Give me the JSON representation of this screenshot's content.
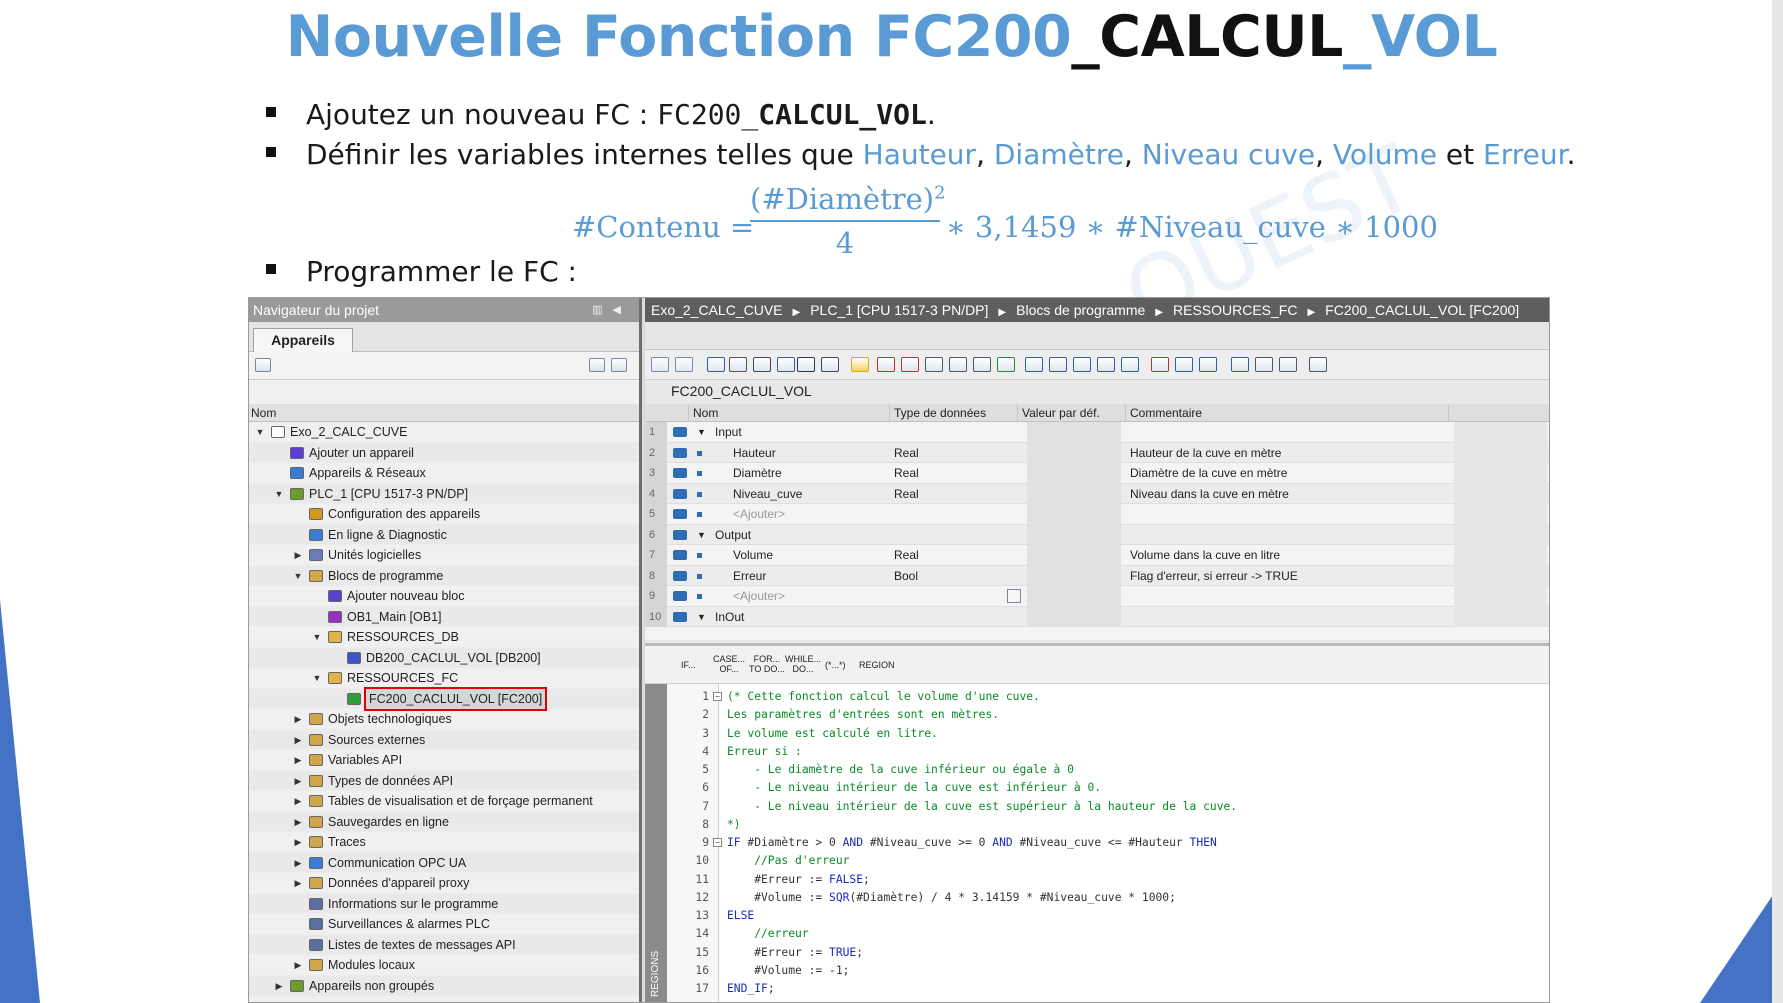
{
  "slide": {
    "title_prefix": "Nouvelle Fonction FC200",
    "title_mid": "_CALCUL",
    "title_suffix": "_VOL",
    "bullet1_text": "Ajoutez un nouveau FC : ",
    "bullet1_code_a": "FC200_",
    "bullet1_code_b": "CALCUL_VOL",
    "bullet1_end": ".",
    "bullet2_text": "Définir les variables internes telles que ",
    "bullet2_vars": [
      "Hauteur",
      "Diamètre",
      "Niveau cuve",
      "Volume",
      "Erreur"
    ],
    "bullet2_sep1": ", ",
    "bullet2_and": " et ",
    "bullet2_end": ".",
    "bullet3_text": "Programmer le FC :",
    "formula": {
      "lhs": "#Contenu =",
      "numerator": "(#Diamètre)",
      "exponent": "2",
      "denominator": "4",
      "rhs": "∗ 3,1459 ∗ #Niveau_cuve  ∗ 1000"
    }
  },
  "navigator": {
    "title": "Navigateur du projet",
    "tab": "Appareils",
    "column": "Nom",
    "tree": [
      {
        "label": "Exo_2_CALC_CUVE",
        "level": 0,
        "exp": "▼",
        "icon": "project-icon",
        "color": "#ffffff"
      },
      {
        "label": "Ajouter un appareil",
        "level": 1,
        "exp": "",
        "icon": "add-device-icon",
        "color": "#5a3fd0"
      },
      {
        "label": "Appareils & Réseaux",
        "level": 1,
        "exp": "",
        "icon": "network-icon",
        "color": "#3a7bd5"
      },
      {
        "label": "PLC_1 [CPU 1517-3 PN/DP]",
        "level": 1,
        "exp": "▼",
        "icon": "plc-icon",
        "color": "#6c9c2d"
      },
      {
        "label": "Configuration des appareils",
        "level": 2,
        "exp": "",
        "icon": "config-icon",
        "color": "#d09a1f"
      },
      {
        "label": "En ligne & Diagnostic",
        "level": 2,
        "exp": "",
        "icon": "diagnostic-icon",
        "color": "#3a7bd5"
      },
      {
        "label": "Unités logicielles",
        "level": 2,
        "exp": "▶",
        "icon": "software-units-icon",
        "color": "#6b7bb5"
      },
      {
        "label": "Blocs de programme",
        "level": 2,
        "exp": "▼",
        "icon": "program-blocks-icon",
        "color": "#d0a64a"
      },
      {
        "label": "Ajouter nouveau bloc",
        "level": 3,
        "exp": "",
        "icon": "add-block-icon",
        "color": "#5a3fd0"
      },
      {
        "label": "OB1_Main [OB1]",
        "level": 3,
        "exp": "",
        "icon": "ob-icon",
        "color": "#9a2fc6"
      },
      {
        "label": "RESSOURCES_DB",
        "level": 3,
        "exp": "▼",
        "icon": "folder-icon",
        "color": "#e0b44a"
      },
      {
        "label": "DB200_CACLUL_VOL [DB200]",
        "level": 4,
        "exp": "",
        "icon": "db-icon",
        "color": "#3a56c8"
      },
      {
        "label": "RESSOURCES_FC",
        "level": 3,
        "exp": "▼",
        "icon": "folder-icon",
        "color": "#e0b44a"
      },
      {
        "label": "FC200_CACLUL_VOL [FC200]",
        "level": 4,
        "exp": "",
        "icon": "fc-icon",
        "color": "#2e9e3a",
        "highlight": true
      },
      {
        "label": "Objets technologiques",
        "level": 2,
        "exp": "▶",
        "icon": "tech-objects-icon",
        "color": "#d0a64a"
      },
      {
        "label": "Sources externes",
        "level": 2,
        "exp": "▶",
        "icon": "external-sources-icon",
        "color": "#d0a64a"
      },
      {
        "label": "Variables API",
        "level": 2,
        "exp": "▶",
        "icon": "plc-tags-icon",
        "color": "#d0a64a"
      },
      {
        "label": "Types de données API",
        "level": 2,
        "exp": "▶",
        "icon": "data-types-icon",
        "color": "#d0a64a"
      },
      {
        "label": "Tables de visualisation et de forçage permanent",
        "level": 2,
        "exp": "▶",
        "icon": "watch-tables-icon",
        "color": "#d0a64a"
      },
      {
        "label": "Sauvegardes en ligne",
        "level": 2,
        "exp": "▶",
        "icon": "online-backup-icon",
        "color": "#d0a64a"
      },
      {
        "label": "Traces",
        "level": 2,
        "exp": "▶",
        "icon": "traces-icon",
        "color": "#d0a64a"
      },
      {
        "label": "Communication OPC UA",
        "level": 2,
        "exp": "▶",
        "icon": "opcua-icon",
        "color": "#3a7bd5"
      },
      {
        "label": "Données d'appareil proxy",
        "level": 2,
        "exp": "▶",
        "icon": "proxy-data-icon",
        "color": "#d0a64a"
      },
      {
        "label": "Informations sur le programme",
        "level": 2,
        "exp": "",
        "icon": "program-info-icon",
        "color": "#5a6fa0"
      },
      {
        "label": "Surveillances & alarmes PLC",
        "level": 2,
        "exp": "",
        "icon": "alarms-icon",
        "color": "#5a6fa0"
      },
      {
        "label": "Listes de textes de messages API",
        "level": 2,
        "exp": "",
        "icon": "text-lists-icon",
        "color": "#5a6fa0"
      },
      {
        "label": "Modules locaux",
        "level": 2,
        "exp": "▶",
        "icon": "local-modules-icon",
        "color": "#d0a64a"
      },
      {
        "label": "Appareils non groupés",
        "level": 1,
        "exp": "▶",
        "icon": "ungrouped-devices-icon",
        "color": "#6c9c2d"
      }
    ]
  },
  "editor": {
    "breadcrumb": [
      "Exo_2_CALC_CUVE",
      "PLC_1 [CPU 1517-3 PN/DP]",
      "Blocs de programme",
      "RESSOURCES_FC",
      "FC200_CACLUL_VOL [FC200]"
    ],
    "block_name": "FC200_CACLUL_VOL",
    "columns": {
      "name": "Nom",
      "type": "Type de données",
      "default": "Valeur par déf.",
      "comment": "Commentaire"
    },
    "interface": [
      {
        "n": "1",
        "name": "Input",
        "type": "",
        "comment": "",
        "section": true
      },
      {
        "n": "2",
        "name": "Hauteur",
        "type": "Real",
        "comment": "Hauteur de la cuve en mètre"
      },
      {
        "n": "3",
        "name": "Diamètre",
        "type": "Real",
        "comment": "Diamètre de la cuve en mètre"
      },
      {
        "n": "4",
        "name": "Niveau_cuve",
        "type": "Real",
        "comment": "Niveau dans la cuve en mètre"
      },
      {
        "n": "5",
        "name": "<Ajouter>",
        "type": "",
        "comment": "",
        "placeholder": true
      },
      {
        "n": "6",
        "name": "Output",
        "type": "",
        "comment": "",
        "section": true
      },
      {
        "n": "7",
        "name": "Volume",
        "type": "Real",
        "comment": "Volume dans la cuve en litre"
      },
      {
        "n": "8",
        "name": "Erreur",
        "type": "Bool",
        "comment": "Flag d'erreur, si erreur -> TRUE"
      },
      {
        "n": "9",
        "name": "<Ajouter>",
        "type": "",
        "comment": "",
        "placeholder": true
      },
      {
        "n": "10",
        "name": "InOut",
        "type": "",
        "comment": "",
        "section": true
      }
    ],
    "code_tools": [
      {
        "l1": "IF...",
        "l2": ""
      },
      {
        "l1": "CASE...",
        "l2": "OF..."
      },
      {
        "l1": "FOR...",
        "l2": "TO DO..."
      },
      {
        "l1": "WHILE...",
        "l2": "DO..."
      },
      {
        "l1": "(*...*)",
        "l2": ""
      },
      {
        "l1": "REGION",
        "l2": ""
      }
    ],
    "regions_label": "REGIONS",
    "code": [
      {
        "n": "1",
        "fold": "−",
        "segs": [
          [
            "cmt",
            "(* Cette fonction calcul le volume d'une cuve."
          ]
        ]
      },
      {
        "n": "2",
        "segs": [
          [
            "cmt",
            "Les paramètres d'entrées sont en mètres."
          ]
        ]
      },
      {
        "n": "3",
        "segs": [
          [
            "cmt",
            "Le volume est calculé en litre."
          ]
        ]
      },
      {
        "n": "4",
        "segs": [
          [
            "cmt",
            "Erreur si :"
          ]
        ]
      },
      {
        "n": "5",
        "segs": [
          [
            "cmt",
            "    - Le diamètre de la cuve inférieur ou égale à 0"
          ]
        ]
      },
      {
        "n": "6",
        "segs": [
          [
            "cmt",
            "    - Le niveau intérieur de la cuve est inférieur à 0."
          ]
        ]
      },
      {
        "n": "7",
        "segs": [
          [
            "cmt",
            "    - Le niveau intérieur de la cuve est supérieur à la hauteur de la cuve."
          ]
        ]
      },
      {
        "n": "8",
        "segs": [
          [
            "cmt",
            "*)"
          ]
        ]
      },
      {
        "n": "9",
        "fold": "−",
        "segs": [
          [
            "kw",
            "IF "
          ],
          [
            "var",
            "#Diamètre > 0 "
          ],
          [
            "kw",
            "AND "
          ],
          [
            "var",
            "#Niveau_cuve >= 0 "
          ],
          [
            "kw",
            "AND "
          ],
          [
            "var",
            "#Niveau_cuve <= #Hauteur "
          ],
          [
            "kw",
            "THEN"
          ]
        ]
      },
      {
        "n": "10",
        "segs": [
          [
            "cmt",
            "    //Pas d'erreur"
          ]
        ]
      },
      {
        "n": "11",
        "segs": [
          [
            "var",
            "    #Erreur := "
          ],
          [
            "kw",
            "FALSE"
          ],
          [
            "var",
            ";"
          ]
        ]
      },
      {
        "n": "12",
        "segs": [
          [
            "var",
            "    #Volume := "
          ],
          [
            "kw",
            "SQR"
          ],
          [
            "var",
            "(#Diamètre) / 4 * 3.14159 * #Niveau_cuve * 1000;"
          ]
        ]
      },
      {
        "n": "13",
        "segs": [
          [
            "kw",
            "ELSE"
          ]
        ]
      },
      {
        "n": "14",
        "segs": [
          [
            "cmt",
            "    //erreur"
          ]
        ]
      },
      {
        "n": "15",
        "segs": [
          [
            "var",
            "    #Erreur := "
          ],
          [
            "kw",
            "TRUE"
          ],
          [
            "var",
            ";"
          ]
        ]
      },
      {
        "n": "16",
        "segs": [
          [
            "var",
            "    #Volume := -1;"
          ]
        ]
      },
      {
        "n": "17",
        "segs": [
          [
            "kw",
            "END_IF"
          ],
          [
            "var",
            ";"
          ]
        ]
      }
    ]
  }
}
